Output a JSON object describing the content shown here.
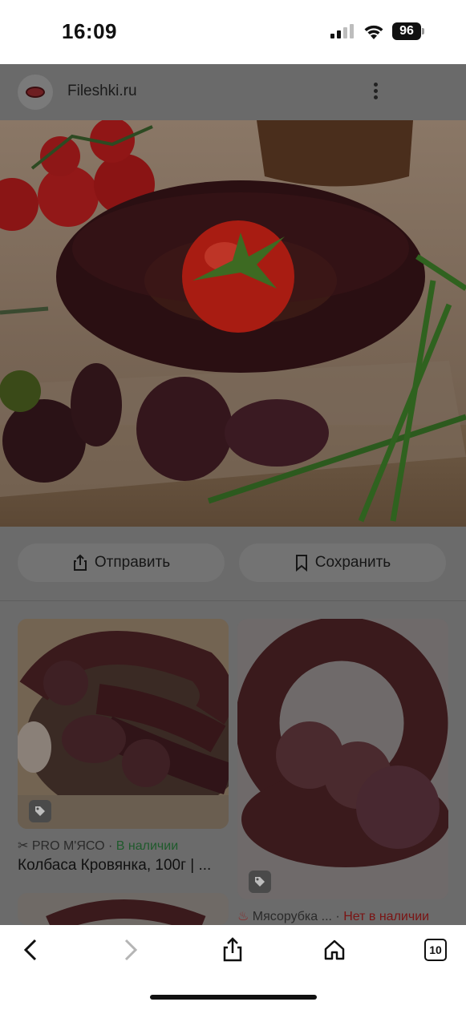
{
  "status": {
    "time": "16:09",
    "battery": "96"
  },
  "site": {
    "name": "Fileshki.ru",
    "favicon_icon": "sausage-logo-icon"
  },
  "actions": {
    "send_label": "Отправить",
    "save_label": "Сохранить"
  },
  "results": [
    {
      "source": "PRO М'ЯСО",
      "separator": "·",
      "availability": "В наличии",
      "title": "Колбаса Кровянка, 100г | ..."
    },
    {
      "source": "Мясорубка ...",
      "separator": "·",
      "availability": "Нет в наличии"
    }
  ],
  "toolbar": {
    "tabs_count": "10"
  },
  "colors": {
    "dim_overlay": "#6b6b6b",
    "in_stock": "#1f5a2c",
    "out_of_stock": "#7a1414"
  }
}
